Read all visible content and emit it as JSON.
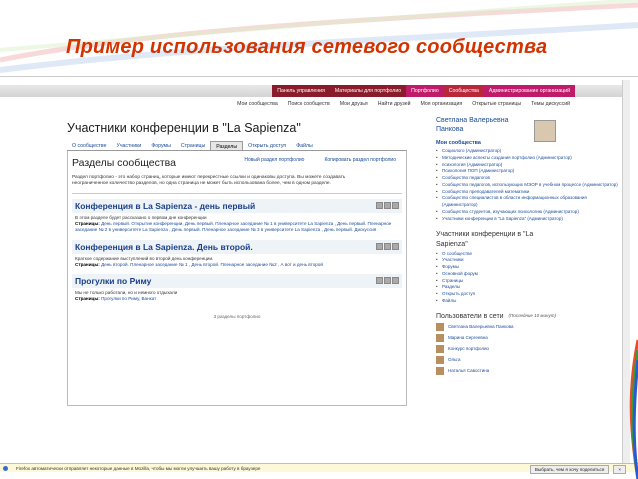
{
  "slide": {
    "title": "Пример использования сетевого сообщества"
  },
  "top_nav": [
    "Панель управления",
    "Материалы для портфолио",
    "Портфолио",
    "Сообщества",
    "Администрирование организаций"
  ],
  "sub_nav": [
    "Мои сообщества",
    "Поиск сообществ",
    "Мои друзья",
    "Найти друзей",
    "Моя организация",
    "Открытые страницы",
    "Темы дискуссий"
  ],
  "main": {
    "heading": "Участники конференции в \"La Sapienza\"",
    "tabs": [
      "О сообществе",
      "Участники",
      "Форумы",
      "Страницы",
      "Разделы",
      "Открыть доступ",
      "Файлы"
    ],
    "section_title": "Разделы сообщества",
    "actions": [
      "Новый раздел портфолио",
      "Копировать раздел портфолио"
    ],
    "desc": "Раздел портфолио - это набор страниц, которые имеют перекрестные ссылки и одинаковы доступа. Вы можете создавать неограниченное количество разделов, но одна страница не может быть использована более, чем в одном разделе.",
    "posts": [
      {
        "title": "Конференция в La Sapienza - день первый",
        "body": "В этом разделе будет рассказано о первом дне конференции",
        "pages_label": "Страницы:",
        "pages": "День первый. Открытие конференции, День первый. Пленарное заседание № 1 в университете La Sapienza , День первый. Пленарное заседание № 2 в университете La Sapienza , День первый. Пленарное заседание № 3 в университете La Sapienza , День первый. Дискуссия"
      },
      {
        "title": "Конференция в La Sapienza. День второй.",
        "body": "Краткое содержание выступлений во второй день конференции.",
        "pages_label": "Страницы:",
        "pages": "День второй. Пленарное заседание № 1 , День второй. Пленарное заседание №2 , А вот и день второй"
      },
      {
        "title": "Прогулки по Риму",
        "body": "Мы не только работали, но и немного отдыхали",
        "pages_label": "Страницы:",
        "pages": "Прогулки по Риму, Ванкат"
      }
    ],
    "count": "3 разделы портфолио"
  },
  "sidebar": {
    "user_name": "Светлана Валерьевна Панкова",
    "communities_head": "Мои сообщества",
    "communities": [
      "Социолого (Администратор)",
      "Методические аспекты создания портфолио (Администратор)",
      "психология (Администратор)",
      "Психология ПОП (Администратор)",
      "Сообщество педагогов",
      "Сообщество педагогов, использующих МЭОР в учебном процессе (Администратор)",
      "Сообщество преподавателей математики",
      "Сообщество специалистов в области информационных образования (Администратор)",
      "Сообщество студентов, изучающих психологию (Администратор)",
      "Участники конференции в \"La Sapienza\" (Администратор)"
    ],
    "block_title": "Участники конференции в \"La Sapienza\"",
    "block_links": [
      "О сообществе",
      "Участники",
      "Форумы",
      "Основной форум",
      "Страницы",
      "Разделы",
      "Открыть доступ",
      "Файлы"
    ],
    "members_title": "Пользователи в сети",
    "members_note": "(Последние 10 минут)",
    "members": [
      "Светлана Валерьевна Панкова",
      "Марина Сергеевна",
      "Конкурс портфолио",
      "Ольга",
      "Наталья Савостина"
    ]
  },
  "statusbar": {
    "message": "Firefox автоматически отправляет некоторые данные в Mozilla, чтобы мы могли улучшить вашу работу в браузере",
    "buttons": [
      "Выбрать, чем я хочу поделиться",
      "×"
    ]
  }
}
